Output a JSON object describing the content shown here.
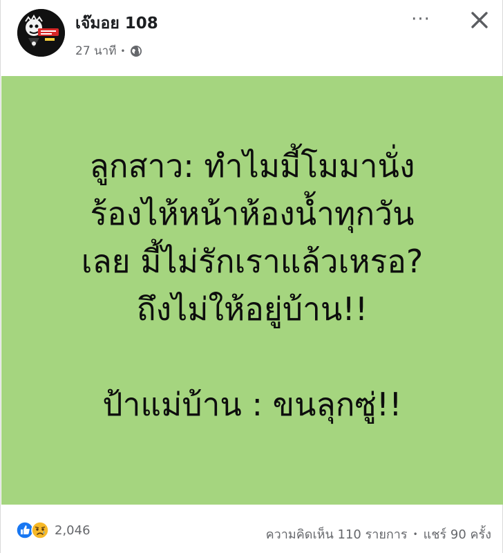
{
  "post": {
    "author": "เจ๊มอย 108",
    "time": "27 นาที",
    "privacy_icon": "globe-icon",
    "more_icon": "more-horizontal-icon",
    "close_icon": "close-icon",
    "more_label": "···"
  },
  "content": {
    "background_color": "#a5d57f",
    "lines": [
      "ลูกสาว: ทำไมมี้โมมานั่ง",
      "ร้องไห้หน้าห้องน้ำทุกวัน",
      "เลย มี้ไม่รักเราแล้วเหรอ?",
      "ถึงไม่ให้อยู่บ้าน!!",
      "ป้าแม่บ้าน : ขนลุกซู่!!"
    ]
  },
  "footer": {
    "reaction_icons": [
      "like-icon",
      "sad-icon"
    ],
    "reaction_count": "2,046",
    "comments": "ความคิดเห็น 110 รายการ",
    "shares": "แชร์ 90 ครั้ง",
    "separator": "•"
  },
  "colors": {
    "like": "#1877f2",
    "sad": "#f7b928",
    "secondary_text": "#65676b"
  }
}
